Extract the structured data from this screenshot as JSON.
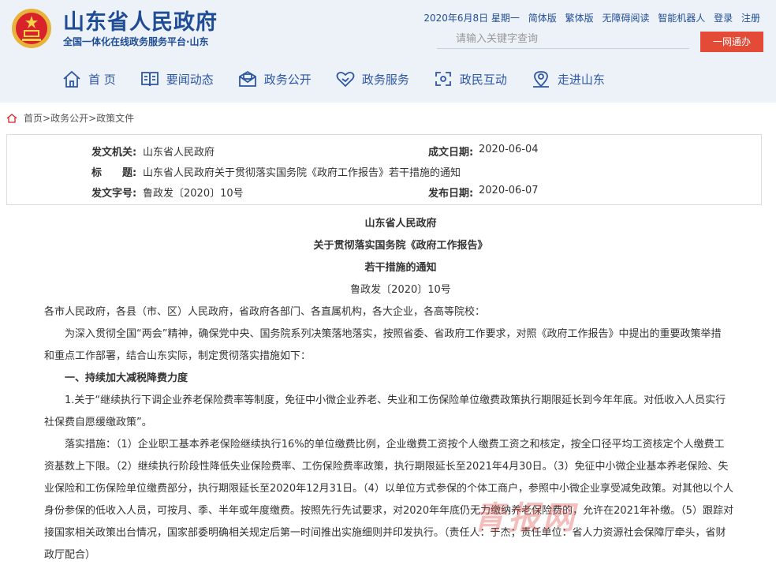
{
  "header": {
    "site_title": "山东省人民政府",
    "site_subtitle": "全国一体化在线政务服务平台·山东",
    "toplinks": {
      "date": "2020年6月8日 星期一",
      "links": [
        "简体版",
        "繁体版",
        "无障碍阅读",
        "智能机器人",
        "登录",
        "注册"
      ]
    },
    "search_placeholder": "请输入关键字查询",
    "one_net_button": "一网通办",
    "nav": [
      "首 页",
      "要闻动态",
      "政务公开",
      "政务服务",
      "政民互动",
      "走进山东"
    ]
  },
  "breadcrumb": [
    "首页",
    "政务公开",
    "政策文件"
  ],
  "meta": {
    "issuer_label": "发文机关:",
    "issuer": "山东省人民政府",
    "date_written_label": "成文日期:",
    "date_written": "2020-06-04",
    "title_label": "标　　题:",
    "title": "山东省人民政府关于贯彻落实国务院《政府工作报告》若干措施的通知",
    "doc_number_label": "发文字号:",
    "doc_number": "鲁政发〔2020〕10号",
    "publish_date_label": "发布日期:",
    "publish_date": "2020-06-07"
  },
  "document": {
    "heading1": "山东省人民政府",
    "heading2": "关于贯彻落实国务院《政府工作报告》",
    "heading3": "若干措施的通知",
    "doc_number": "鲁政发〔2020〕10号",
    "recipients": "各市人民政府，各县（市、区）人民政府，省政府各部门、各直属机构，各大企业，各高等院校：",
    "intro_lines": [
      "为深入贯彻全国“两会”精神，确保党中央、国务院系列决策落地落实，按照省委、省政府工作要求，对照《政府工作报告》中提出的重要政策举措",
      "和重点工作部署，结合山东实际，制定贯彻落实措施如下："
    ],
    "section1": "一、持续加大减税降费力度",
    "item1_lines": [
      "1.关于“继续执行下调企业养老保险费率等制度，免征中小微企业养老、失业和工伤保险单位缴费政策执行期限延长到今年年底。对低收入人员实行",
      "社保费自愿缓缴政策”。"
    ],
    "measures_lines": [
      "落实措施：（1）企业职工基本养老保险继续执行16%的单位缴费比例，企业缴费工资按个人缴费工资之和核定，按全口径平均工资核定个人缴费工",
      "资基数上下限。（2）继续执行阶段性降低失业保险费率、工伤保险费率政策，执行期限延长至2021年4月30日。（3）免征中小微企业基本养老保险、失",
      "业保险和工伤保险单位缴费部分，执行期限延长至2020年12月31日。（4）以单位方式参保的个体工商户，参照中小微企业享受减免政策。对其他以个人",
      "身份参保的低收入人员，可按月、季、半年或年度缴费。按照先行先试要求，对2020年年底仍无力缴纳养老保险费的，允许在2021年补缴。（5）跟踪对",
      "接国家相关政策出台情况，国家部委明确相关规定后第一时间推出实施细则并印发执行。（责任人：于杰；责任单位：省人力资源社会保障厅牵头，省财",
      "政厅配合）"
    ]
  },
  "watermark": "青报网"
}
